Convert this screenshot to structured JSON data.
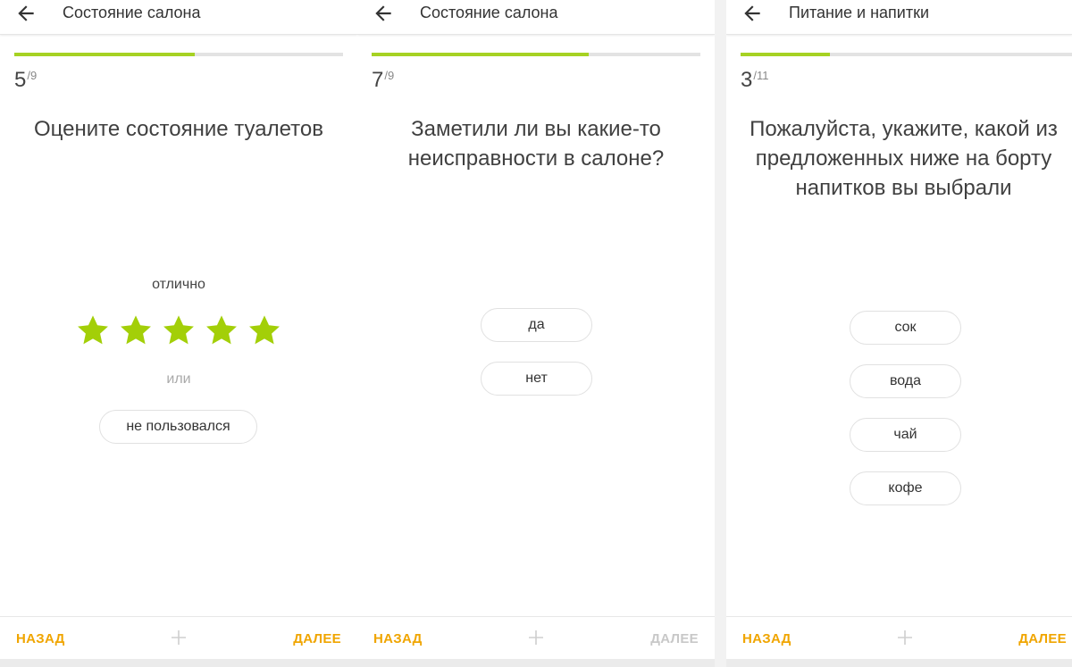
{
  "colors": {
    "accent_green": "#a6d223",
    "star_yellow_green": "#a3cf08",
    "nav_orange": "#f0a500",
    "disabled_gray": "#c8c8c8"
  },
  "screens": [
    {
      "title": "Состояние салона",
      "counter": {
        "current": "5",
        "total": "/9"
      },
      "progress": 0.55,
      "question": "Оцените состояние туалетов",
      "rating_label": "отлично",
      "rating": {
        "value": 5,
        "max": 5
      },
      "or_label": "или",
      "alt_option": "не пользовался",
      "nav": {
        "back": "НАЗАД",
        "next": "ДАЛЕЕ",
        "next_enabled": true
      }
    },
    {
      "title": "Состояние салона",
      "counter": {
        "current": "7",
        "total": "/9"
      },
      "progress": 0.66,
      "question": "Заметили ли вы какие-то неисправности в салоне?",
      "options": [
        "да",
        "нет"
      ],
      "nav": {
        "back": "НАЗАД",
        "next": "ДАЛЕЕ",
        "next_enabled": false
      }
    },
    {
      "title": "Питание и напитки",
      "counter": {
        "current": "3",
        "total": "/11"
      },
      "progress": 0.27,
      "question": "Пожалуйста, укажите, какой из предложенных ниже на борту напитков вы выбрали",
      "options": [
        "сок",
        "вода",
        "чай",
        "кофе"
      ],
      "nav": {
        "back": "НАЗАД",
        "next": "ДАЛЕЕ",
        "next_enabled": true
      }
    }
  ],
  "icons": {
    "back": "arrow-left-icon",
    "add": "plus-icon",
    "star": "star-icon"
  }
}
